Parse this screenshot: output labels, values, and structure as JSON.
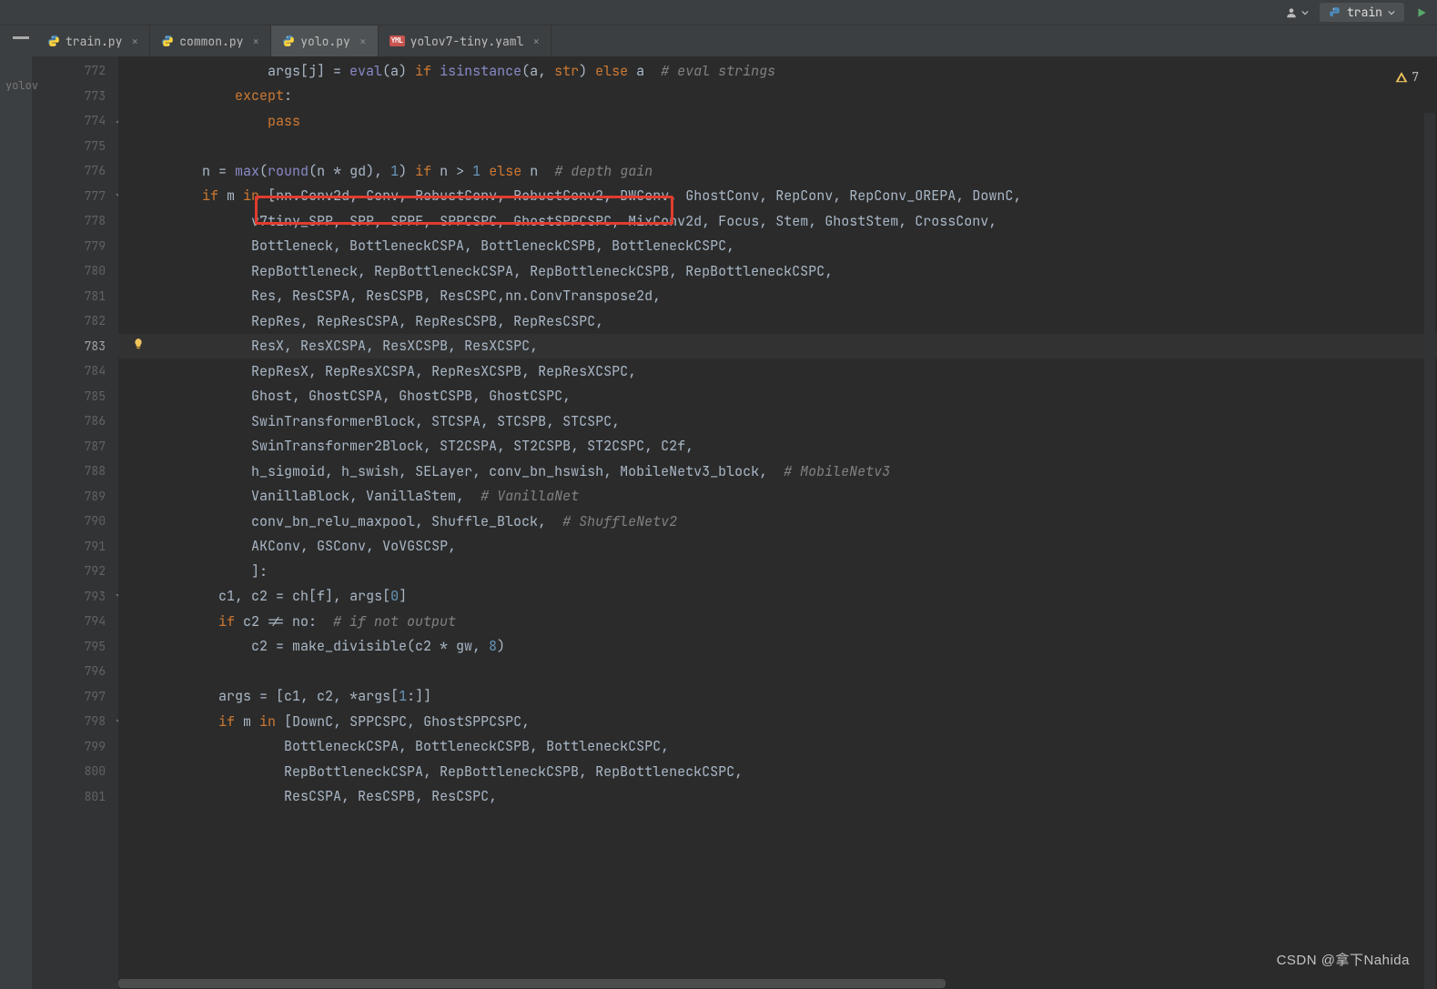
{
  "toolbar": {
    "run_config_label": "train"
  },
  "tabs": [
    {
      "label": "train.py",
      "kind": "py",
      "active": false
    },
    {
      "label": "common.py",
      "kind": "py",
      "active": false
    },
    {
      "label": "yolo.py",
      "kind": "py",
      "active": true
    },
    {
      "label": "yolov7-tiny.yaml",
      "kind": "yaml",
      "active": false
    }
  ],
  "left_rail_text": "yolov",
  "warnings_count": "7",
  "watermark": "CSDN @拿下Nahida",
  "gutter": {
    "start": 772,
    "end": 801,
    "current": 783,
    "folds": {
      "774": "up",
      "777": "down",
      "793": "down",
      "798": "down"
    },
    "bulb": 783
  },
  "hl_box": {
    "line_index": 6,
    "left_ch": 14,
    "width_ch": 47
  },
  "code": [
    [
      [
        "id",
        "                args[j] = "
      ],
      [
        "fn",
        "eval"
      ],
      [
        "id",
        "(a) "
      ],
      [
        "kw",
        "if "
      ],
      [
        "fn",
        "isinstance"
      ],
      [
        "id",
        "(a"
      ],
      [
        "op",
        ", "
      ],
      [
        "kw",
        "str"
      ],
      [
        "id",
        ") "
      ],
      [
        "kw",
        "else"
      ],
      [
        "id",
        " a  "
      ],
      [
        "cmt",
        "# eval strings"
      ]
    ],
    [
      [
        "id",
        "            "
      ],
      [
        "kw",
        "except"
      ],
      [
        "id",
        ":"
      ]
    ],
    [
      [
        "id",
        "                "
      ],
      [
        "kw",
        "pass"
      ]
    ],
    [
      [
        "id",
        ""
      ]
    ],
    [
      [
        "id",
        "        n = "
      ],
      [
        "fn",
        "max"
      ],
      [
        "id",
        "("
      ],
      [
        "fn",
        "round"
      ],
      [
        "id",
        "(n * gd)"
      ],
      [
        "op",
        ", "
      ],
      [
        "num",
        "1"
      ],
      [
        "id",
        ") "
      ],
      [
        "kw",
        "if"
      ],
      [
        "id",
        " n > "
      ],
      [
        "num",
        "1"
      ],
      [
        "id",
        " "
      ],
      [
        "kw",
        "else"
      ],
      [
        "id",
        " n  "
      ],
      [
        "cmt",
        "# depth gain"
      ]
    ],
    [
      [
        "id",
        "        "
      ],
      [
        "kw",
        "if"
      ],
      [
        "id",
        " m "
      ],
      [
        "kw",
        "in"
      ],
      [
        "id",
        " [nn.Conv2d"
      ],
      [
        "op",
        ", "
      ],
      [
        "id",
        "Conv"
      ],
      [
        "op",
        ", "
      ],
      [
        "id",
        "RobustConv"
      ],
      [
        "op",
        ", "
      ],
      [
        "id",
        "RobustConv2"
      ],
      [
        "op",
        ", "
      ],
      [
        "id",
        "DWConv"
      ],
      [
        "op",
        ", "
      ],
      [
        "id",
        "GhostConv"
      ],
      [
        "op",
        ", "
      ],
      [
        "id",
        "RepConv"
      ],
      [
        "op",
        ", "
      ],
      [
        "id",
        "RepConv_OREPA"
      ],
      [
        "op",
        ", "
      ],
      [
        "id",
        "DownC"
      ],
      [
        "op",
        ","
      ]
    ],
    [
      [
        "id",
        "              v7tiny_SPP"
      ],
      [
        "op",
        ", "
      ],
      [
        "id",
        "SPP"
      ],
      [
        "op",
        ", "
      ],
      [
        "id",
        "SPPF"
      ],
      [
        "op",
        ", "
      ],
      [
        "id",
        "SPPCSPC"
      ],
      [
        "op",
        ", "
      ],
      [
        "id",
        "GhostSPPCSPC"
      ],
      [
        "op",
        ", "
      ],
      [
        "id",
        "MixConv2d"
      ],
      [
        "op",
        ", "
      ],
      [
        "id",
        "Focus"
      ],
      [
        "op",
        ", "
      ],
      [
        "id",
        "Stem"
      ],
      [
        "op",
        ", "
      ],
      [
        "id",
        "GhostStem"
      ],
      [
        "op",
        ", "
      ],
      [
        "id",
        "CrossConv"
      ],
      [
        "op",
        ","
      ]
    ],
    [
      [
        "id",
        "              Bottleneck"
      ],
      [
        "op",
        ", "
      ],
      [
        "id",
        "BottleneckCSPA"
      ],
      [
        "op",
        ", "
      ],
      [
        "id",
        "BottleneckCSPB"
      ],
      [
        "op",
        ", "
      ],
      [
        "id",
        "BottleneckCSPC"
      ],
      [
        "op",
        ","
      ]
    ],
    [
      [
        "id",
        "              RepBottleneck"
      ],
      [
        "op",
        ", "
      ],
      [
        "id",
        "RepBottleneckCSPA"
      ],
      [
        "op",
        ", "
      ],
      [
        "id",
        "RepBottleneckCSPB"
      ],
      [
        "op",
        ", "
      ],
      [
        "id",
        "RepBottleneckCSPC"
      ],
      [
        "op",
        ","
      ]
    ],
    [
      [
        "id",
        "              Res"
      ],
      [
        "op",
        ", "
      ],
      [
        "id",
        "ResCSPA"
      ],
      [
        "op",
        ", "
      ],
      [
        "id",
        "ResCSPB"
      ],
      [
        "op",
        ", "
      ],
      [
        "id",
        "ResCSPC"
      ],
      [
        "op",
        ","
      ],
      [
        "id",
        "nn.ConvTranspose2d"
      ],
      [
        "op",
        ","
      ]
    ],
    [
      [
        "id",
        "              RepRes"
      ],
      [
        "op",
        ", "
      ],
      [
        "id",
        "RepResCSPA"
      ],
      [
        "op",
        ", "
      ],
      [
        "id",
        "RepResCSPB"
      ],
      [
        "op",
        ", "
      ],
      [
        "id",
        "RepResCSPC"
      ],
      [
        "op",
        ","
      ]
    ],
    [
      [
        "id",
        "              ResX"
      ],
      [
        "op",
        ", "
      ],
      [
        "id",
        "ResXCSPA"
      ],
      [
        "op",
        ", "
      ],
      [
        "id",
        "ResXCSPB"
      ],
      [
        "op",
        ", "
      ],
      [
        "id",
        "ResXCSPC"
      ],
      [
        "op",
        ","
      ]
    ],
    [
      [
        "id",
        "              RepResX"
      ],
      [
        "op",
        ", "
      ],
      [
        "id",
        "RepResXCSPA"
      ],
      [
        "op",
        ", "
      ],
      [
        "id",
        "RepResXCSPB"
      ],
      [
        "op",
        ", "
      ],
      [
        "id",
        "RepResXCSPC"
      ],
      [
        "op",
        ","
      ]
    ],
    [
      [
        "id",
        "              Ghost"
      ],
      [
        "op",
        ", "
      ],
      [
        "id",
        "GhostCSPA"
      ],
      [
        "op",
        ", "
      ],
      [
        "id",
        "GhostCSPB"
      ],
      [
        "op",
        ", "
      ],
      [
        "id",
        "GhostCSPC"
      ],
      [
        "op",
        ","
      ]
    ],
    [
      [
        "id",
        "              SwinTransformerBlock"
      ],
      [
        "op",
        ", "
      ],
      [
        "id",
        "STCSPA"
      ],
      [
        "op",
        ", "
      ],
      [
        "id",
        "STCSPB"
      ],
      [
        "op",
        ", "
      ],
      [
        "id",
        "STCSPC"
      ],
      [
        "op",
        ","
      ]
    ],
    [
      [
        "id",
        "              SwinTransformer2Block"
      ],
      [
        "op",
        ", "
      ],
      [
        "id",
        "ST2CSPA"
      ],
      [
        "op",
        ", "
      ],
      [
        "id",
        "ST2CSPB"
      ],
      [
        "op",
        ", "
      ],
      [
        "id",
        "ST2CSPC"
      ],
      [
        "op",
        ", "
      ],
      [
        "id",
        "C2f"
      ],
      [
        "op",
        ","
      ]
    ],
    [
      [
        "id",
        "              h_sigmoid"
      ],
      [
        "op",
        ", "
      ],
      [
        "id",
        "h_swish"
      ],
      [
        "op",
        ", "
      ],
      [
        "id",
        "SELayer"
      ],
      [
        "op",
        ", "
      ],
      [
        "id",
        "conv_bn_hswish"
      ],
      [
        "op",
        ", "
      ],
      [
        "id",
        "MobileNetv3_block"
      ],
      [
        "op",
        ",  "
      ],
      [
        "cmt",
        "# MobileNetv3"
      ]
    ],
    [
      [
        "id",
        "              VanillaBlock"
      ],
      [
        "op",
        ", "
      ],
      [
        "id",
        "VanillaStem"
      ],
      [
        "op",
        ",  "
      ],
      [
        "cmt",
        "# VanillaNet"
      ]
    ],
    [
      [
        "id",
        "              conv_bn_relu_maxpool"
      ],
      [
        "op",
        ", "
      ],
      [
        "id",
        "Shuffle_Block"
      ],
      [
        "op",
        ",  "
      ],
      [
        "cmt",
        "# ShuffleNetv2"
      ]
    ],
    [
      [
        "id",
        "              AKConv"
      ],
      [
        "op",
        ", "
      ],
      [
        "id",
        "GSConv"
      ],
      [
        "op",
        ", "
      ],
      [
        "id",
        "VoVGSCSP"
      ],
      [
        "op",
        ","
      ]
    ],
    [
      [
        "id",
        "              ]:"
      ]
    ],
    [
      [
        "id",
        "          c1"
      ],
      [
        "op",
        ", "
      ],
      [
        "id",
        "c2 = ch[f]"
      ],
      [
        "op",
        ", "
      ],
      [
        "id",
        "args["
      ],
      [
        "num",
        "0"
      ],
      [
        "id",
        "]"
      ]
    ],
    [
      [
        "id",
        "          "
      ],
      [
        "kw",
        "if"
      ],
      [
        "id",
        " c2 != no:  "
      ],
      [
        "cmt",
        "# if not output"
      ]
    ],
    [
      [
        "id",
        "              c2 = make_divisible(c2 * gw"
      ],
      [
        "op",
        ", "
      ],
      [
        "num",
        "8"
      ],
      [
        "id",
        ")"
      ]
    ],
    [
      [
        "id",
        ""
      ]
    ],
    [
      [
        "id",
        "          args = [c1"
      ],
      [
        "op",
        ", "
      ],
      [
        "id",
        "c2"
      ],
      [
        "op",
        ", "
      ],
      [
        "id",
        "*args["
      ],
      [
        "num",
        "1"
      ],
      [
        "id",
        ":]]"
      ]
    ],
    [
      [
        "id",
        "          "
      ],
      [
        "kw",
        "if"
      ],
      [
        "id",
        " m "
      ],
      [
        "kw",
        "in"
      ],
      [
        "id",
        " [DownC"
      ],
      [
        "op",
        ", "
      ],
      [
        "id",
        "SPPCSPC"
      ],
      [
        "op",
        ", "
      ],
      [
        "id",
        "GhostSPPCSPC"
      ],
      [
        "op",
        ","
      ]
    ],
    [
      [
        "id",
        "                  BottleneckCSPA"
      ],
      [
        "op",
        ", "
      ],
      [
        "id",
        "BottleneckCSPB"
      ],
      [
        "op",
        ", "
      ],
      [
        "id",
        "BottleneckCSPC"
      ],
      [
        "op",
        ","
      ]
    ],
    [
      [
        "id",
        "                  RepBottleneckCSPA"
      ],
      [
        "op",
        ", "
      ],
      [
        "id",
        "RepBottleneckCSPB"
      ],
      [
        "op",
        ", "
      ],
      [
        "id",
        "RepBottleneckCSPC"
      ],
      [
        "op",
        ","
      ]
    ],
    [
      [
        "id",
        "                  ResCSPA"
      ],
      [
        "op",
        ", "
      ],
      [
        "id",
        "ResCSPB"
      ],
      [
        "op",
        ", "
      ],
      [
        "id",
        "ResCSPC"
      ],
      [
        "op",
        ","
      ]
    ]
  ]
}
